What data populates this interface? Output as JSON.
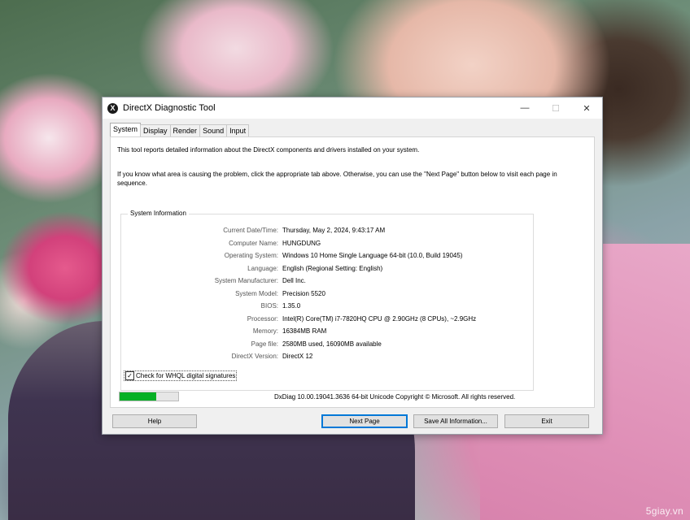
{
  "window": {
    "title": "DirectX Diagnostic Tool",
    "app_icon_glyph": "X",
    "controls": {
      "minimize": "—",
      "maximize": "☐",
      "close": "✕"
    }
  },
  "tabs": [
    {
      "label": "System",
      "active": true
    },
    {
      "label": "Display",
      "active": false
    },
    {
      "label": "Render",
      "active": false
    },
    {
      "label": "Sound",
      "active": false
    },
    {
      "label": "Input",
      "active": false
    }
  ],
  "intro_text": "This tool reports detailed information about the DirectX components and drivers installed on your system.",
  "help_text": "If you know what area is causing the problem, click the appropriate tab above.  Otherwise, you can use the \"Next Page\" button below to visit each page in sequence.",
  "system_info": {
    "group_title": "System Information",
    "rows": [
      {
        "label": "Current Date/Time:",
        "value": "Thursday, May 2, 2024, 9:43:17 AM"
      },
      {
        "label": "Computer Name:",
        "value": "HUNGDUNG"
      },
      {
        "label": "Operating System:",
        "value": "Windows 10 Home Single Language 64-bit (10.0, Build 19045)"
      },
      {
        "label": "Language:",
        "value": "English (Regional Setting: English)"
      },
      {
        "label": "System Manufacturer:",
        "value": "Dell Inc."
      },
      {
        "label": "System Model:",
        "value": "Precision 5520"
      },
      {
        "label": "BIOS:",
        "value": "1.35.0"
      },
      {
        "label": "Processor:",
        "value": "Intel(R) Core(TM) i7-7820HQ CPU @ 2.90GHz (8 CPUs), ~2.9GHz"
      },
      {
        "label": "Memory:",
        "value": "16384MB RAM"
      },
      {
        "label": "Page file:",
        "value": "2580MB used, 16090MB available"
      },
      {
        "label": "DirectX Version:",
        "value": "DirectX 12"
      }
    ]
  },
  "whql_checkbox": {
    "label": "Check for WHQL digital signatures",
    "checked": true,
    "check_glyph": "✓"
  },
  "progress": {
    "percent": 62
  },
  "copyright": "DxDiag 10.00.19041.3636 64-bit Unicode  Copyright © Microsoft. All rights reserved.",
  "buttons": {
    "help": "Help",
    "next_page": "Next Page",
    "save_all": "Save All Information...",
    "exit": "Exit"
  },
  "watermark": "5giay.vn",
  "colors": {
    "progress_fill": "#06b025",
    "default_button_border": "#0078d7"
  }
}
